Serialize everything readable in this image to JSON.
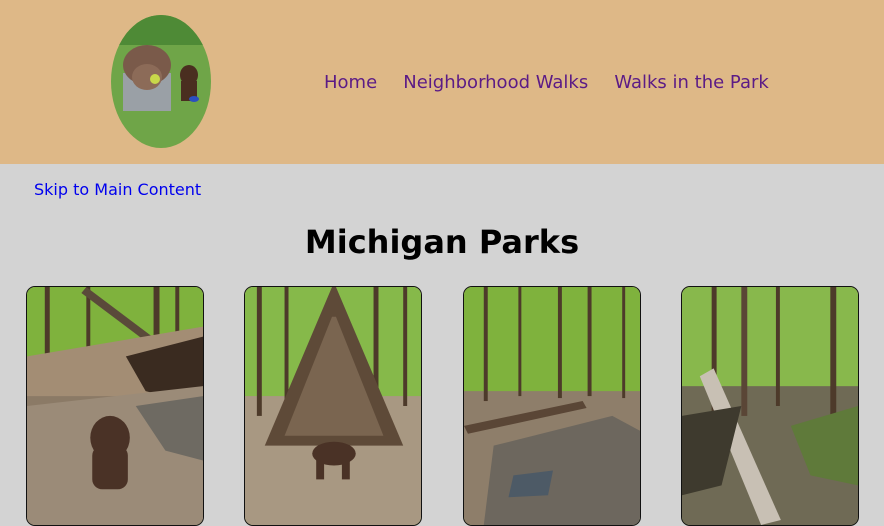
{
  "header": {
    "logo_icon": "bison-statue-and-dog-photo-icon",
    "nav": [
      "Home",
      "Neighborhood Walks",
      "Walks in the Park"
    ]
  },
  "skip_link": "Skip to Main Content",
  "main": {
    "title": "Michigan Parks",
    "photos": [
      {
        "icon": "dog-by-creek-photo-icon"
      },
      {
        "icon": "stick-teepee-and-dog-photo-icon"
      },
      {
        "icon": "dry-creek-bed-photo-icon"
      },
      {
        "icon": "fallen-log-in-woods-photo-icon"
      }
    ]
  },
  "colors": {
    "header_bg": "#deb887",
    "page_bg": "#d3d3d3",
    "nav_link": "#5b1b86",
    "skip_link": "#0000ee"
  }
}
